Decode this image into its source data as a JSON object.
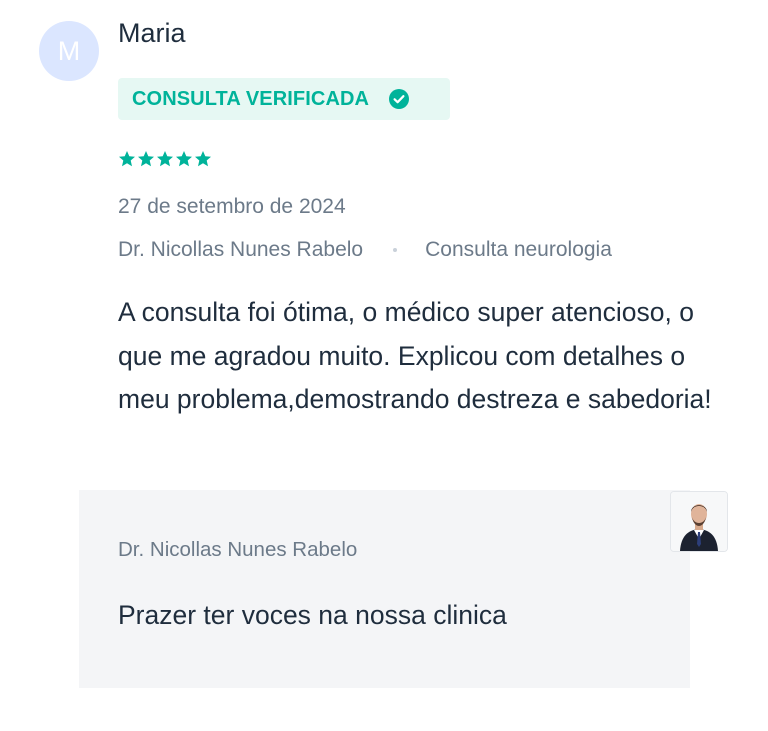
{
  "review": {
    "avatar_initial": "M",
    "author_name": "Maria",
    "verified_label": "CONSULTA VERIFICADA",
    "rating": 5,
    "rating_max": 5,
    "date": "27 de setembro de 2024",
    "doctor_name": "Dr. Nicollas Nunes Rabelo",
    "consultation_type": "Consulta neurologia",
    "text": "A consulta foi ótima, o médico super atencioso, o que me agradou muito. Explicou com detalhes o meu problema,demostrando destreza e sabedoria!"
  },
  "reply": {
    "author": "Dr. Nicollas Nunes Rabelo",
    "text": "Prazer ter voces na nossa clinica"
  },
  "colors": {
    "accent": "#00b39a",
    "badge_background": "#e6f8f3",
    "avatar_background": "#dbe6ff",
    "reply_background": "#f4f5f7",
    "text_primary": "#1f2d3d",
    "text_secondary": "#6c7a89"
  },
  "icons": {
    "verified": "check-circle-icon",
    "rating": "star-icon",
    "doctor_photo": "doctor-avatar-photo"
  }
}
